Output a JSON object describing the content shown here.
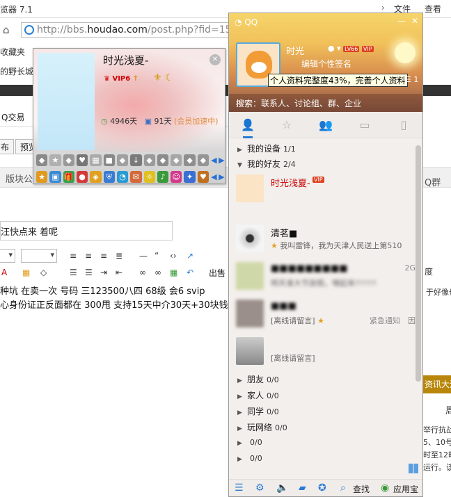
{
  "browser": {
    "title": "览器 7.1",
    "menu": [
      "文件",
      "查看"
    ],
    "url_prefix": "http://bbs.",
    "url_domain": "houdao.com",
    "url_rest": "/post.php?fid=152",
    "bookmarks": [
      "收藏夹",
      "的野长城"
    ],
    "nav_item": "Q交易",
    "buttons": [
      "布",
      "预览"
    ],
    "tabs": [
      "版块公",
      "Q群"
    ],
    "subject_value": "汪快点来 着呢",
    "editor_line1": "种坑 在卖一次 号码 三123500八四 68级 会6 svip",
    "editor_line1_right": "于好像也",
    "editor_line2": "心身份证正反面都在 300甩 支持15天中介30天+30块钱",
    "toolbar_chushou": "出售",
    "toolbar_du": "度",
    "right_tab": "资讯大满",
    "right_lines": [
      "周",
      "举行抗战",
      "5、10号",
      "时至12时",
      "运行。该"
    ]
  },
  "card": {
    "name": "时光浅夏-",
    "vip": "VIP6",
    "days_green": "4946天",
    "days_blue": "91天",
    "accel": "(会员加速中)",
    "row1_icons": [
      "diamond-icon",
      "star-icon",
      "diamond-icon",
      "heart-icon",
      "grid-icon",
      "square-icon",
      "diamond-icon",
      "down-icon",
      "diamond-icon",
      "diamond-icon",
      "diamond-icon",
      "diamond-icon",
      "diamond-icon"
    ],
    "row2_icons": [
      "star-icon",
      "app-icon",
      "gift-icon",
      "pet-icon",
      "game-icon",
      "shield-icon",
      "qq-icon",
      "mail-icon",
      "sun-icon",
      "music-icon",
      "user-icon",
      "bird-icon",
      "heart-icon"
    ]
  },
  "qq": {
    "logo": "QQ",
    "nickname": "时光",
    "level": "LV66",
    "vip_badge": "VIP",
    "signature": "编辑个性签名",
    "tooltip": "个人资料完整度43%，完善个人资料",
    "tooltip_count": "1",
    "search_placeholder": "搜索：联系人、讨论组、群、企业",
    "groups": [
      {
        "name": "我的设备",
        "count": "1/1",
        "open": false
      },
      {
        "name": "我的好友",
        "count": "2/4",
        "open": true
      },
      {
        "name": "朋友",
        "count": "0/0",
        "open": false
      },
      {
        "name": "家人",
        "count": "0/0",
        "open": false
      },
      {
        "name": "同学",
        "count": "0/0",
        "open": false
      },
      {
        "name": "玩网络",
        "count": "0/0",
        "open": false
      },
      {
        "name": "",
        "count": "0/0",
        "open": false
      },
      {
        "name": "",
        "count": "0/0",
        "open": false
      }
    ],
    "contacts": [
      {
        "name": "时光浅夏-",
        "status": "",
        "right": "",
        "vip": "VIP"
      },
      {
        "name": "清茗■",
        "status": "我叫雷锋，我为天津人民送上第510",
        "right": ""
      },
      {
        "name": "■■■■■■■■■",
        "status": "明天谁大节放假，嘿起来!!!!!!!",
        "right": "2G"
      },
      {
        "name": "■■■",
        "status": "[离线请留言]",
        "right": "紧急通知　因"
      },
      {
        "name": "",
        "status": "[离线请留言]",
        "right": ""
      }
    ],
    "bottom": {
      "search": "查找",
      "app": "应用宝"
    }
  }
}
